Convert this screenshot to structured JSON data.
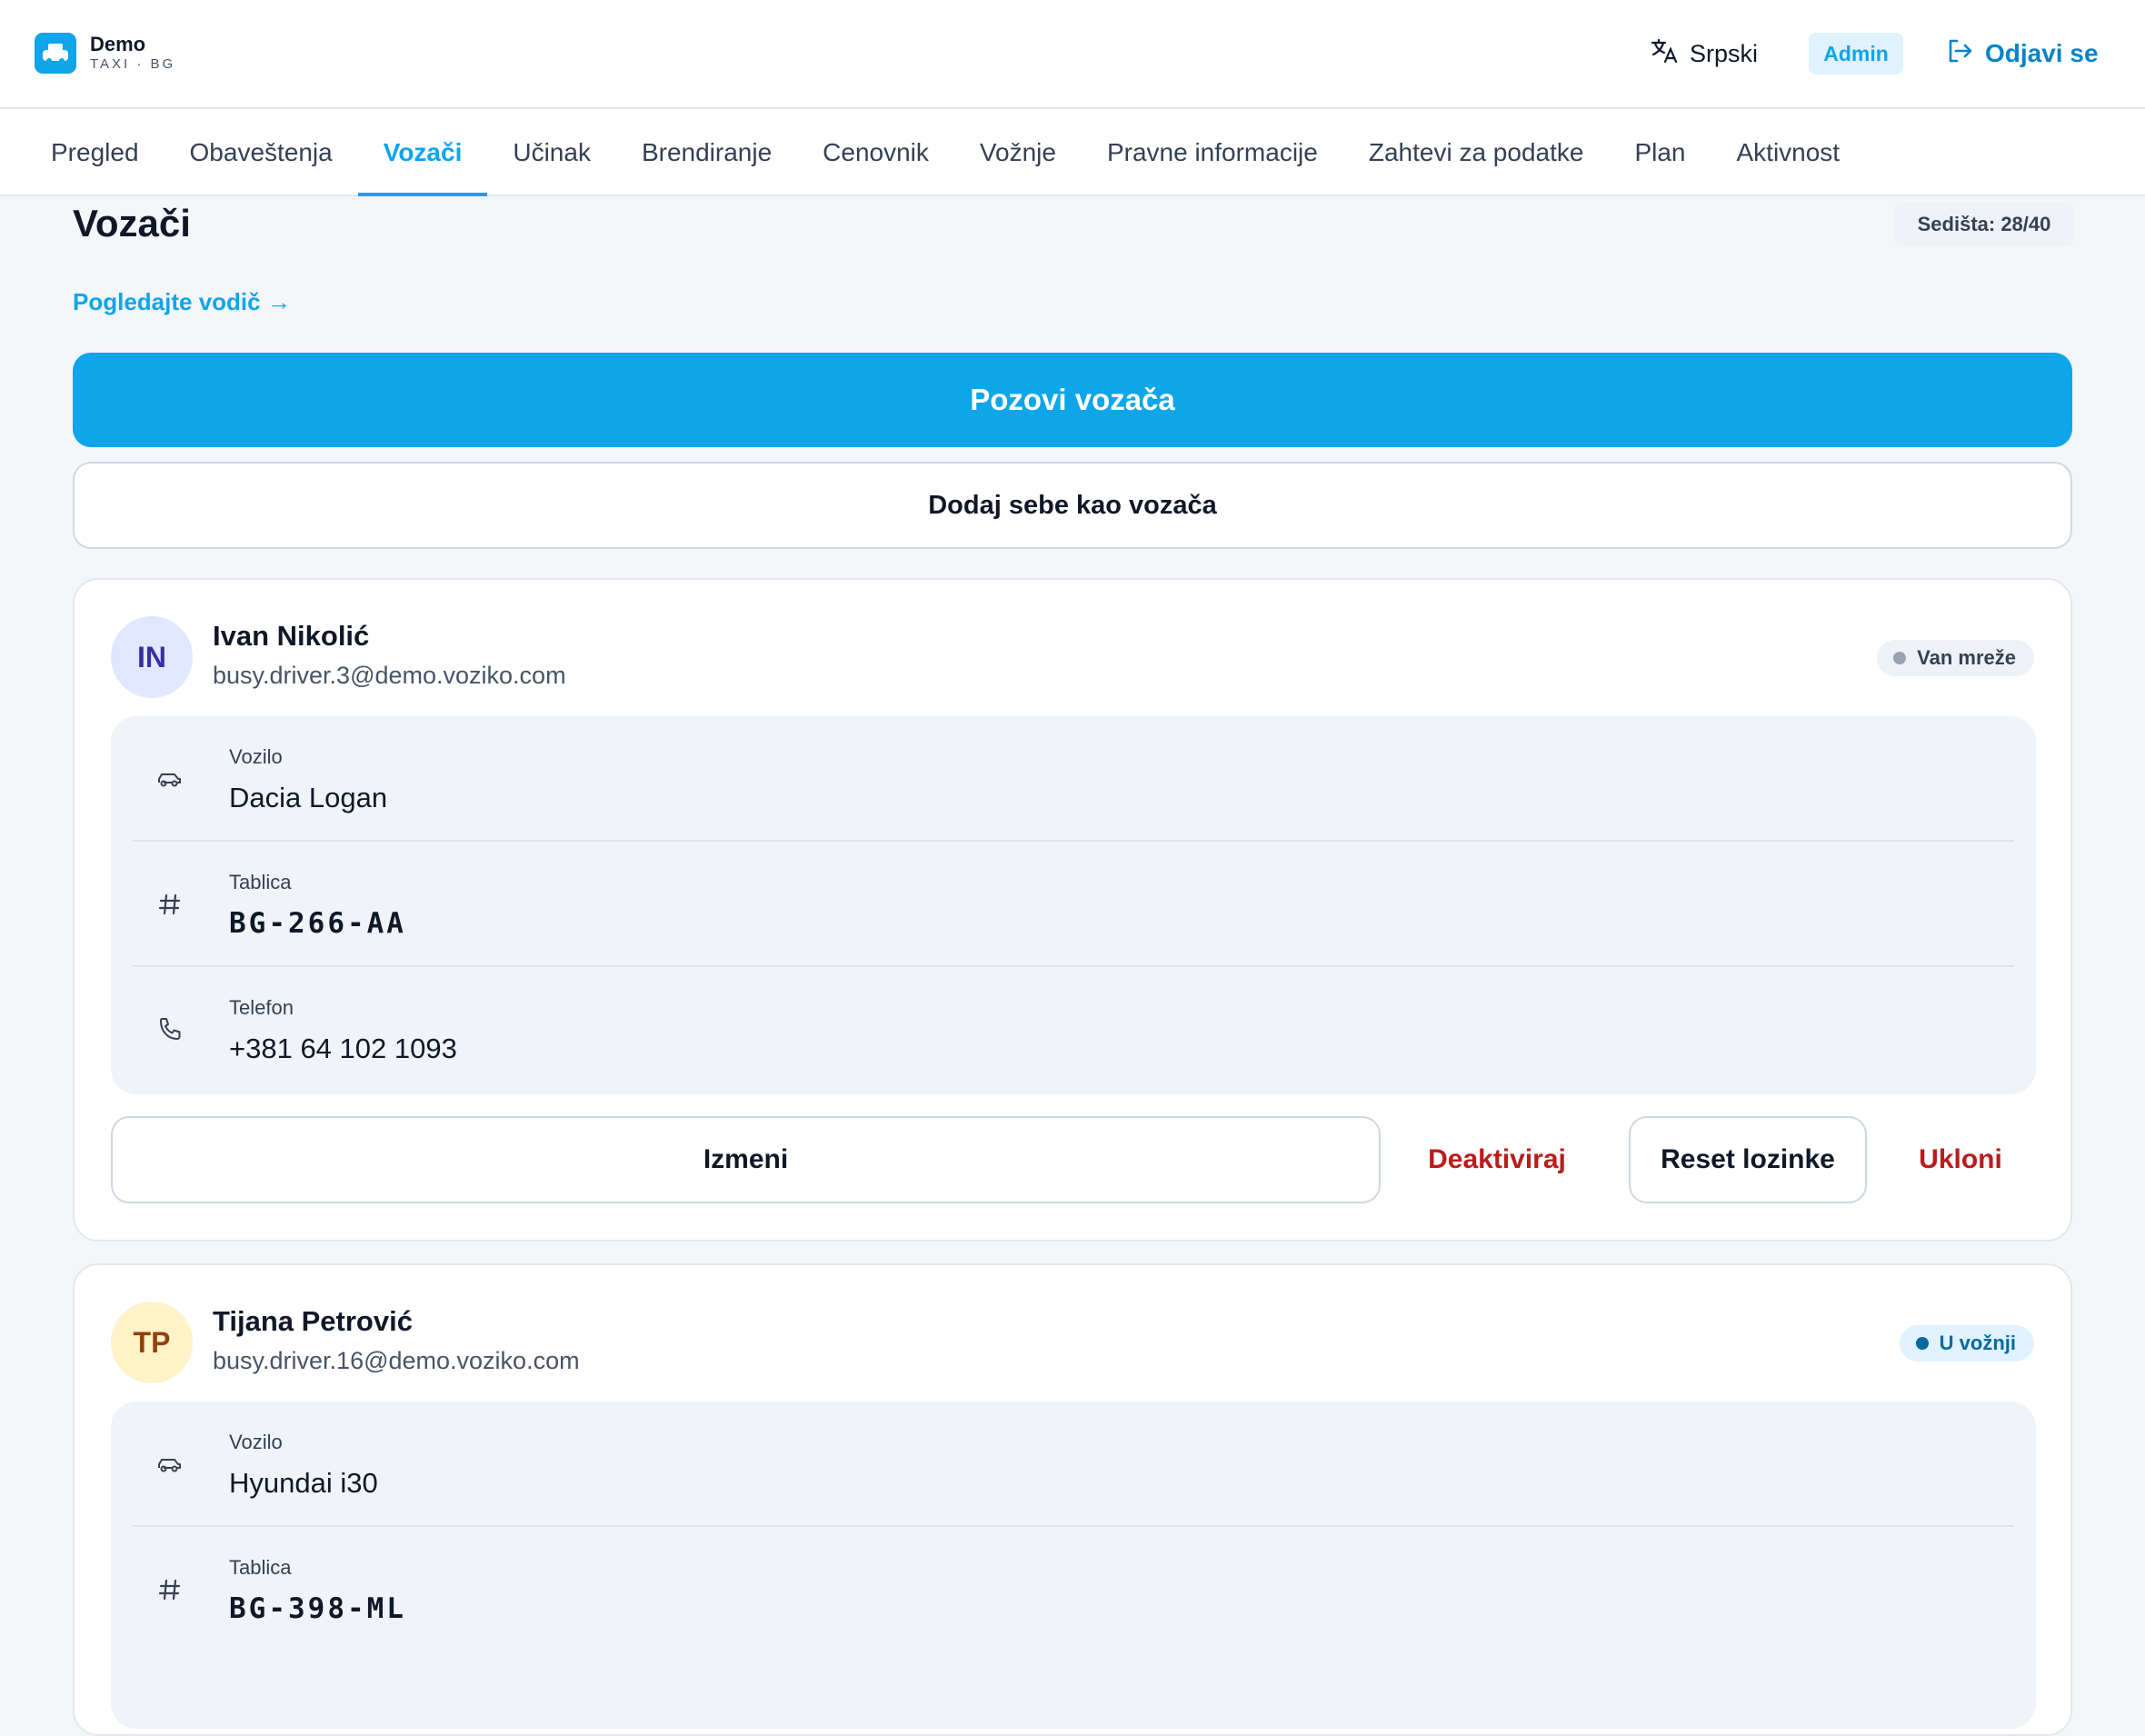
{
  "header": {
    "brand_name": "Demo",
    "brand_sub": "TAXI · BG",
    "language": "Srpski",
    "role_badge": "Admin",
    "logout_label": "Odjavi se"
  },
  "nav": {
    "tabs": [
      {
        "label": "Pregled"
      },
      {
        "label": "Obaveštenja"
      },
      {
        "label": "Vozači"
      },
      {
        "label": "Učinak"
      },
      {
        "label": "Brendiranje"
      },
      {
        "label": "Cenovnik"
      },
      {
        "label": "Vožnje"
      },
      {
        "label": "Pravne informacije"
      },
      {
        "label": "Zahtevi za podatke"
      },
      {
        "label": "Plan"
      },
      {
        "label": "Aktivnost"
      }
    ],
    "active": "Vozači"
  },
  "page": {
    "title": "Vozači",
    "seats": "Sedišta: 28/40",
    "guide_link": "Pogledajte vodič →",
    "invite_button": "Pozovi vozača",
    "add_self_button": "Dodaj sebe kao vozača"
  },
  "labels": {
    "vehicle": "Vozilo",
    "plate": "Tablica",
    "phone": "Telefon",
    "edit": "Izmeni",
    "deactivate": "Deaktiviraj",
    "reset_password": "Reset lozinke",
    "remove": "Ukloni"
  },
  "drivers": [
    {
      "initials": "IN",
      "name": "Ivan Nikolić",
      "email": "busy.driver.3@demo.voziko.com",
      "status": "Van mreže",
      "vehicle": "Dacia Logan",
      "plate": "BG-266-AA",
      "phone": "+381 64 102 1093"
    },
    {
      "initials": "TP",
      "name": "Tijana Petrović",
      "email": "busy.driver.16@demo.voziko.com",
      "status": "U vožnji",
      "vehicle": "Hyundai i30",
      "plate": "BG-398-ML"
    }
  ],
  "colors": {
    "accent": "#0ea5e9",
    "danger": "#b91c1c",
    "background": "#f4f6f9"
  },
  "icons": [
    "taxi-logo-icon",
    "translate-icon",
    "logout-icon",
    "car-icon",
    "hash-icon",
    "phone-icon"
  ]
}
